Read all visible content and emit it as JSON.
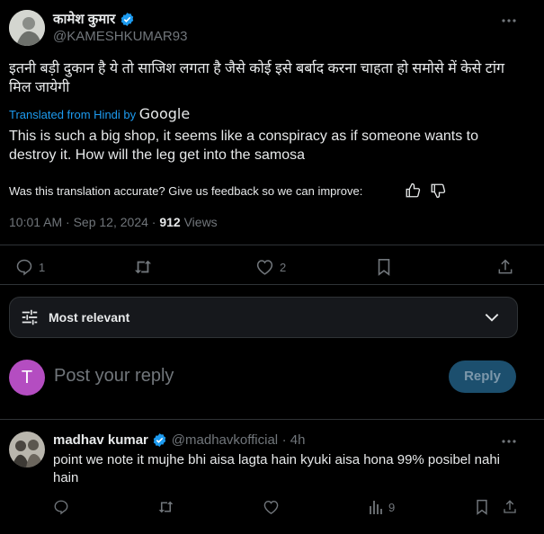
{
  "tweet": {
    "author_name": "कामेश कुमार",
    "author_handle": "@KAMESHKUMAR93",
    "text_original": "इतनी बड़ी दुकान है ये तो साजिश लगता है जैसे कोई इसे बर्बाद करना चाहता हो समोसे में केसे टांग मिल जायेगी",
    "translated_from": "Translated from Hindi by",
    "translator_brand": "Google",
    "text_translated": "This is such a big shop, it seems like a conspiracy as if someone wants to destroy it. How will the leg get into the samosa",
    "feedback_prompt": "Was this translation accurate? Give us feedback so we can improve:",
    "timestamp": "10:01 AM · Sep 12, 2024 · ",
    "views_count": "912",
    "views_label": " Views",
    "replies_count": "1",
    "likes_count": "2"
  },
  "sort": {
    "label": "Most relevant"
  },
  "compose": {
    "avatar_letter": "T",
    "placeholder": "Post your reply",
    "reply_button": "Reply"
  },
  "reply": {
    "author_name": "madhav kumar",
    "author_handle": "@madhavkofficial",
    "time": "· 4h",
    "text": "point we note it mujhe bhi aisa lagta hain kyuki aisa hona 99% posibel nahi hain",
    "views_count": "9"
  },
  "colors": {
    "accent": "#1d9bf0",
    "background": "#000000",
    "muted": "#71767b",
    "compose_avatar": "#b44dc1"
  }
}
